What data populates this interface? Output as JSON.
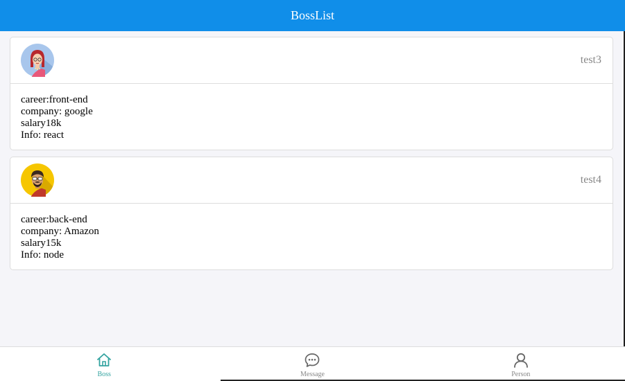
{
  "navbar": {
    "title": "BossList"
  },
  "cards": [
    {
      "name": "test3",
      "avatar": "woman-avatar-icon",
      "career": "career:front-end",
      "company": "company: google",
      "salary": "salary18k",
      "info": "Info: react"
    },
    {
      "name": "test4",
      "avatar": "man-avatar-icon",
      "career": "career:back-end",
      "company": "company: Amazon",
      "salary": "salary15k",
      "info": "Info: node"
    }
  ],
  "tabbar": {
    "tabs": [
      {
        "label": "Boss",
        "icon": "home-icon",
        "active": true
      },
      {
        "label": "Message",
        "icon": "chat-bubble-icon",
        "active": false
      },
      {
        "label": "Person",
        "icon": "person-icon",
        "active": false
      }
    ]
  },
  "colors": {
    "navbar": "#108ee9",
    "background": "#f5f5f9",
    "active_tab": "#33a3a0",
    "inactive_tab": "#888888"
  }
}
